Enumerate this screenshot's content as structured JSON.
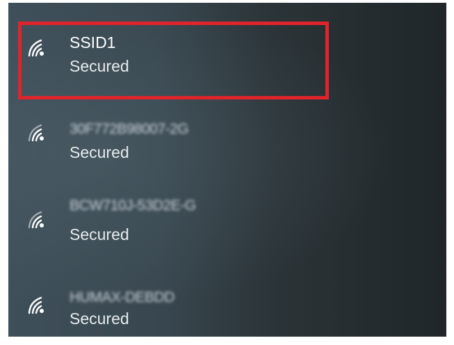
{
  "networks": [
    {
      "ssid": "SSID1",
      "status": "Secured",
      "icon": "wifi-signal-icon"
    },
    {
      "ssid": "30F772B98007-2G",
      "status": "Secured",
      "icon": "wifi-signal-icon"
    },
    {
      "ssid": "BCW710J-53D2E-G",
      "status": "Secured",
      "icon": "wifi-signal-icon"
    },
    {
      "ssid": "HUMAX-DEBDD",
      "status": "Secured",
      "icon": "wifi-signal-icon"
    }
  ],
  "colors": {
    "highlight": "#e0242c",
    "text": "#ffffff"
  }
}
